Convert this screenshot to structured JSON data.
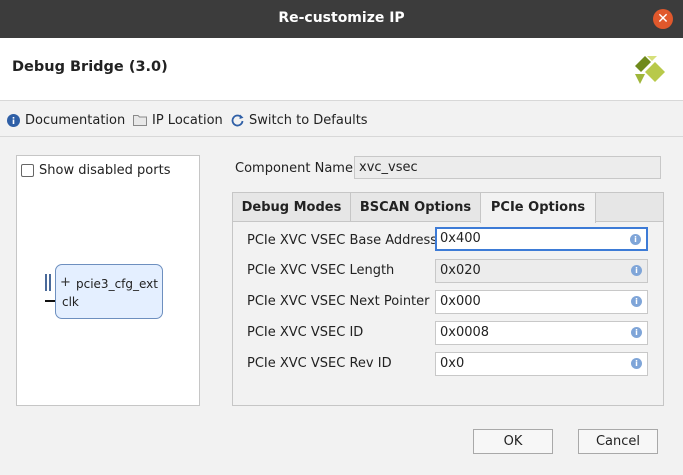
{
  "window": {
    "title": "Re-customize IP",
    "close_glyph": "✕"
  },
  "header": {
    "ip_name": "Debug Bridge (3.0)",
    "logo_icon": "xilinx-logo"
  },
  "toolbar": {
    "documentation": "Documentation",
    "ip_location": "IP Location",
    "switch_defaults": "Switch to Defaults"
  },
  "left_panel": {
    "show_disabled_ports": "Show disabled ports",
    "block": {
      "expand_glyph": "+",
      "bus_port": "pcie3_cfg_ext",
      "clk_port": "clk"
    }
  },
  "component": {
    "label": "Component Name",
    "value": "xvc_vsec"
  },
  "tabs": [
    {
      "label": "Debug Modes",
      "active": false
    },
    {
      "label": "BSCAN Options",
      "active": false
    },
    {
      "label": "PCIe Options",
      "active": true
    }
  ],
  "params": [
    {
      "label": "PCIe XVC VSEC Base Address",
      "value": "0x400",
      "state": "focused"
    },
    {
      "label": "PCIe XVC VSEC Length",
      "value": "0x020",
      "state": "readonly"
    },
    {
      "label": "PCIe XVC VSEC Next Pointer",
      "value": "0x000",
      "state": "normal"
    },
    {
      "label": "PCIe XVC VSEC ID",
      "value": "0x0008",
      "state": "normal"
    },
    {
      "label": "PCIe XVC VSEC Rev ID",
      "value": "0x0",
      "state": "normal"
    }
  ],
  "info_glyph": "i",
  "buttons": {
    "ok": "OK",
    "cancel": "Cancel"
  },
  "colors": {
    "titlebar": "#3c3c3c",
    "close": "#e0582c",
    "focus": "#3d7bd6",
    "info": "#7fa5d8"
  }
}
